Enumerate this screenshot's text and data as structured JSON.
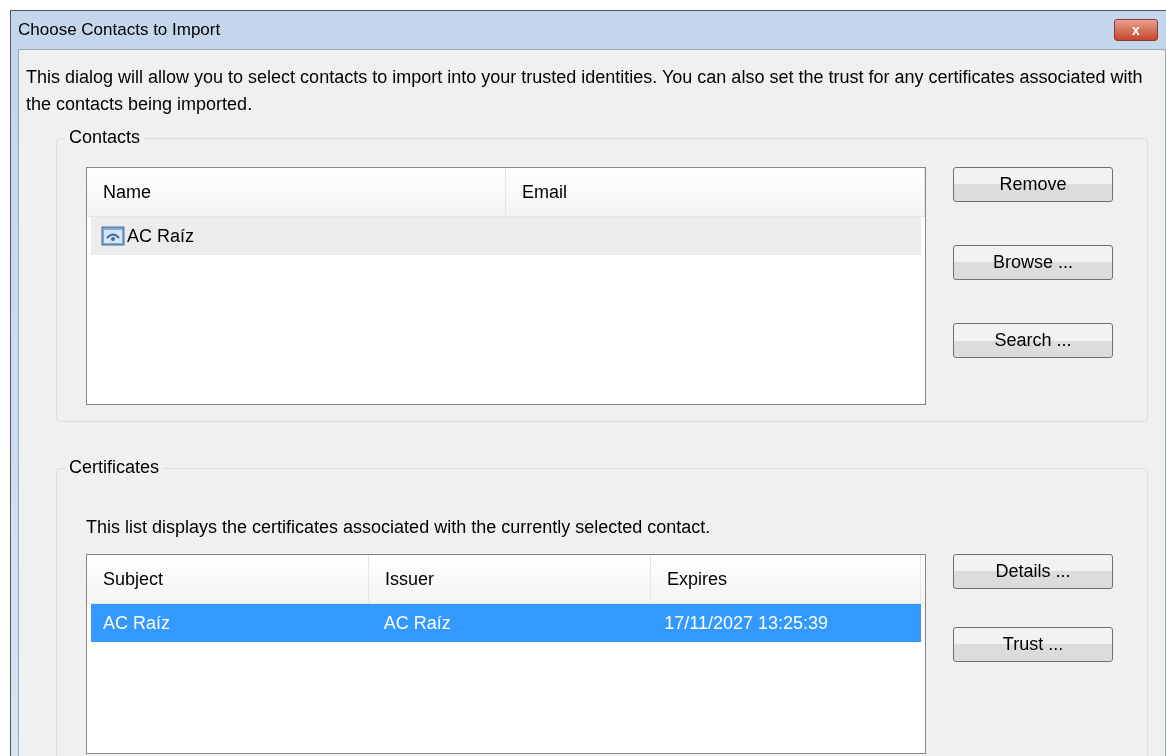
{
  "window": {
    "title": "Choose Contacts to Import",
    "close_label": "x"
  },
  "intro": "This dialog will allow you to select contacts to import into your trusted identities. You can also set the trust for any certificates associated with the contacts being imported.",
  "contacts": {
    "title": "Contacts",
    "columns": [
      "Name",
      "Email"
    ],
    "rows": [
      {
        "cells": [
          "AC Raíz",
          ""
        ],
        "selected": true
      }
    ],
    "buttons": [
      "Remove",
      "Browse ...",
      "Search ..."
    ]
  },
  "certificates": {
    "title": "Certificates",
    "description": "This list displays the certificates associated with the currently selected contact.",
    "columns": [
      "Subject",
      "Issuer",
      "Expires"
    ],
    "rows": [
      {
        "cells": [
          "AC Raíz",
          "AC Raíz",
          "17/11/2027 13:25:39"
        ],
        "selected": true
      }
    ],
    "buttons": [
      "Details ...",
      "Trust ..."
    ]
  }
}
